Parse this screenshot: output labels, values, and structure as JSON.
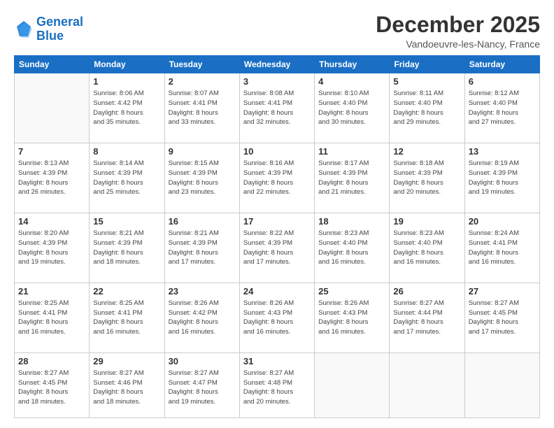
{
  "header": {
    "logo_line1": "General",
    "logo_line2": "Blue",
    "month": "December 2025",
    "location": "Vandoeuvre-les-Nancy, France"
  },
  "days_of_week": [
    "Sunday",
    "Monday",
    "Tuesday",
    "Wednesday",
    "Thursday",
    "Friday",
    "Saturday"
  ],
  "weeks": [
    [
      {
        "num": "",
        "empty": true
      },
      {
        "num": "1",
        "sunrise": "Sunrise: 8:06 AM",
        "sunset": "Sunset: 4:42 PM",
        "daylight": "Daylight: 8 hours and 35 minutes."
      },
      {
        "num": "2",
        "sunrise": "Sunrise: 8:07 AM",
        "sunset": "Sunset: 4:41 PM",
        "daylight": "Daylight: 8 hours and 33 minutes."
      },
      {
        "num": "3",
        "sunrise": "Sunrise: 8:08 AM",
        "sunset": "Sunset: 4:41 PM",
        "daylight": "Daylight: 8 hours and 32 minutes."
      },
      {
        "num": "4",
        "sunrise": "Sunrise: 8:10 AM",
        "sunset": "Sunset: 4:40 PM",
        "daylight": "Daylight: 8 hours and 30 minutes."
      },
      {
        "num": "5",
        "sunrise": "Sunrise: 8:11 AM",
        "sunset": "Sunset: 4:40 PM",
        "daylight": "Daylight: 8 hours and 29 minutes."
      },
      {
        "num": "6",
        "sunrise": "Sunrise: 8:12 AM",
        "sunset": "Sunset: 4:40 PM",
        "daylight": "Daylight: 8 hours and 27 minutes."
      }
    ],
    [
      {
        "num": "7",
        "sunrise": "Sunrise: 8:13 AM",
        "sunset": "Sunset: 4:39 PM",
        "daylight": "Daylight: 8 hours and 26 minutes."
      },
      {
        "num": "8",
        "sunrise": "Sunrise: 8:14 AM",
        "sunset": "Sunset: 4:39 PM",
        "daylight": "Daylight: 8 hours and 25 minutes."
      },
      {
        "num": "9",
        "sunrise": "Sunrise: 8:15 AM",
        "sunset": "Sunset: 4:39 PM",
        "daylight": "Daylight: 8 hours and 23 minutes."
      },
      {
        "num": "10",
        "sunrise": "Sunrise: 8:16 AM",
        "sunset": "Sunset: 4:39 PM",
        "daylight": "Daylight: 8 hours and 22 minutes."
      },
      {
        "num": "11",
        "sunrise": "Sunrise: 8:17 AM",
        "sunset": "Sunset: 4:39 PM",
        "daylight": "Daylight: 8 hours and 21 minutes."
      },
      {
        "num": "12",
        "sunrise": "Sunrise: 8:18 AM",
        "sunset": "Sunset: 4:39 PM",
        "daylight": "Daylight: 8 hours and 20 minutes."
      },
      {
        "num": "13",
        "sunrise": "Sunrise: 8:19 AM",
        "sunset": "Sunset: 4:39 PM",
        "daylight": "Daylight: 8 hours and 19 minutes."
      }
    ],
    [
      {
        "num": "14",
        "sunrise": "Sunrise: 8:20 AM",
        "sunset": "Sunset: 4:39 PM",
        "daylight": "Daylight: 8 hours and 19 minutes."
      },
      {
        "num": "15",
        "sunrise": "Sunrise: 8:21 AM",
        "sunset": "Sunset: 4:39 PM",
        "daylight": "Daylight: 8 hours and 18 minutes."
      },
      {
        "num": "16",
        "sunrise": "Sunrise: 8:21 AM",
        "sunset": "Sunset: 4:39 PM",
        "daylight": "Daylight: 8 hours and 17 minutes."
      },
      {
        "num": "17",
        "sunrise": "Sunrise: 8:22 AM",
        "sunset": "Sunset: 4:39 PM",
        "daylight": "Daylight: 8 hours and 17 minutes."
      },
      {
        "num": "18",
        "sunrise": "Sunrise: 8:23 AM",
        "sunset": "Sunset: 4:40 PM",
        "daylight": "Daylight: 8 hours and 16 minutes."
      },
      {
        "num": "19",
        "sunrise": "Sunrise: 8:23 AM",
        "sunset": "Sunset: 4:40 PM",
        "daylight": "Daylight: 8 hours and 16 minutes."
      },
      {
        "num": "20",
        "sunrise": "Sunrise: 8:24 AM",
        "sunset": "Sunset: 4:41 PM",
        "daylight": "Daylight: 8 hours and 16 minutes."
      }
    ],
    [
      {
        "num": "21",
        "sunrise": "Sunrise: 8:25 AM",
        "sunset": "Sunset: 4:41 PM",
        "daylight": "Daylight: 8 hours and 16 minutes."
      },
      {
        "num": "22",
        "sunrise": "Sunrise: 8:25 AM",
        "sunset": "Sunset: 4:41 PM",
        "daylight": "Daylight: 8 hours and 16 minutes."
      },
      {
        "num": "23",
        "sunrise": "Sunrise: 8:26 AM",
        "sunset": "Sunset: 4:42 PM",
        "daylight": "Daylight: 8 hours and 16 minutes."
      },
      {
        "num": "24",
        "sunrise": "Sunrise: 8:26 AM",
        "sunset": "Sunset: 4:43 PM",
        "daylight": "Daylight: 8 hours and 16 minutes."
      },
      {
        "num": "25",
        "sunrise": "Sunrise: 8:26 AM",
        "sunset": "Sunset: 4:43 PM",
        "daylight": "Daylight: 8 hours and 16 minutes."
      },
      {
        "num": "26",
        "sunrise": "Sunrise: 8:27 AM",
        "sunset": "Sunset: 4:44 PM",
        "daylight": "Daylight: 8 hours and 17 minutes."
      },
      {
        "num": "27",
        "sunrise": "Sunrise: 8:27 AM",
        "sunset": "Sunset: 4:45 PM",
        "daylight": "Daylight: 8 hours and 17 minutes."
      }
    ],
    [
      {
        "num": "28",
        "sunrise": "Sunrise: 8:27 AM",
        "sunset": "Sunset: 4:45 PM",
        "daylight": "Daylight: 8 hours and 18 minutes."
      },
      {
        "num": "29",
        "sunrise": "Sunrise: 8:27 AM",
        "sunset": "Sunset: 4:46 PM",
        "daylight": "Daylight: 8 hours and 18 minutes."
      },
      {
        "num": "30",
        "sunrise": "Sunrise: 8:27 AM",
        "sunset": "Sunset: 4:47 PM",
        "daylight": "Daylight: 8 hours and 19 minutes."
      },
      {
        "num": "31",
        "sunrise": "Sunrise: 8:27 AM",
        "sunset": "Sunset: 4:48 PM",
        "daylight": "Daylight: 8 hours and 20 minutes."
      },
      {
        "num": "",
        "empty": true
      },
      {
        "num": "",
        "empty": true
      },
      {
        "num": "",
        "empty": true
      }
    ]
  ]
}
